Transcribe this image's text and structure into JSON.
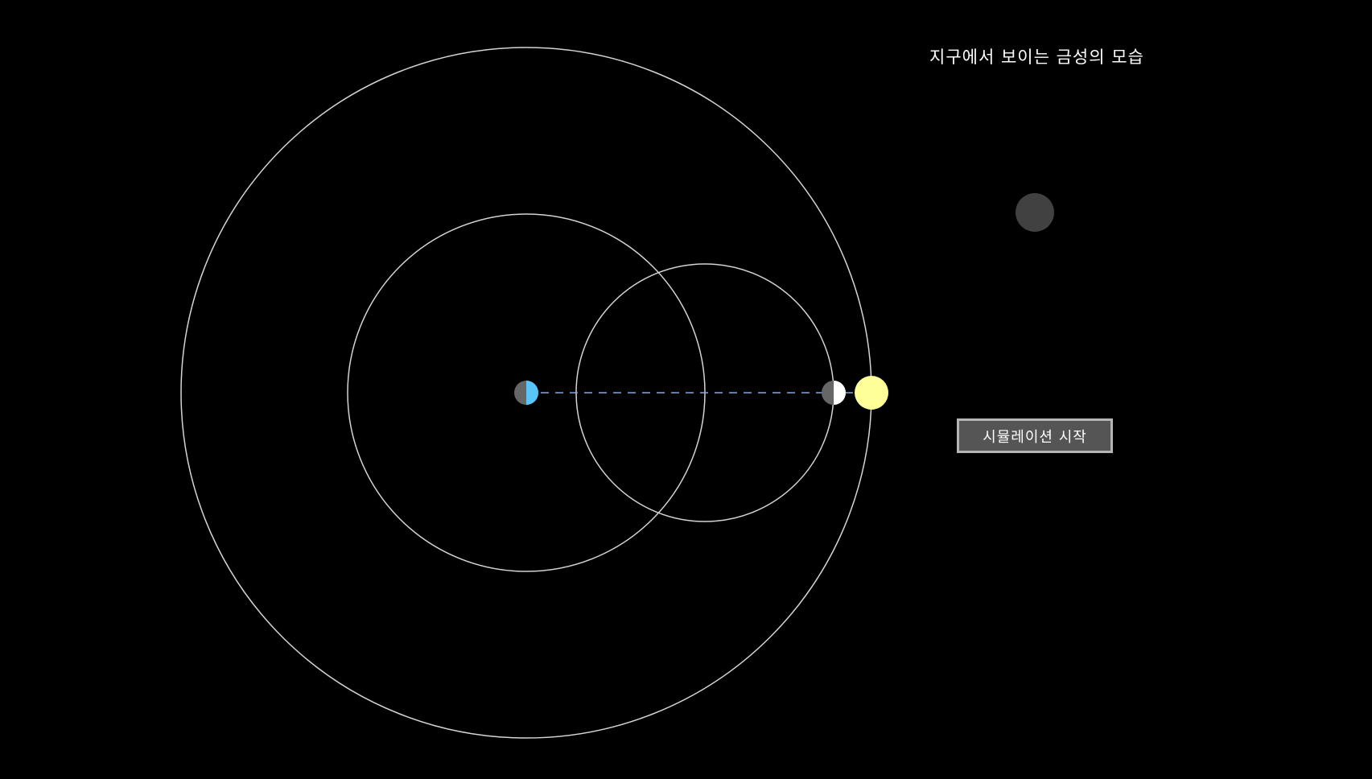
{
  "title": "지구에서 보이는 금성의 모습",
  "button": {
    "label": "시뮬레이션 시작"
  },
  "colors": {
    "background": "#000000",
    "orbit_line": "#d4d4d4",
    "sight_line": "#7fa9e8",
    "earth_lit": "#58c4f7",
    "planet_shadow": "#666666",
    "venus_lit": "#ffffff",
    "sun": "#ffff99",
    "venus_view": "#414141",
    "button_fill": "#555555",
    "button_border": "#b4b4b4"
  }
}
